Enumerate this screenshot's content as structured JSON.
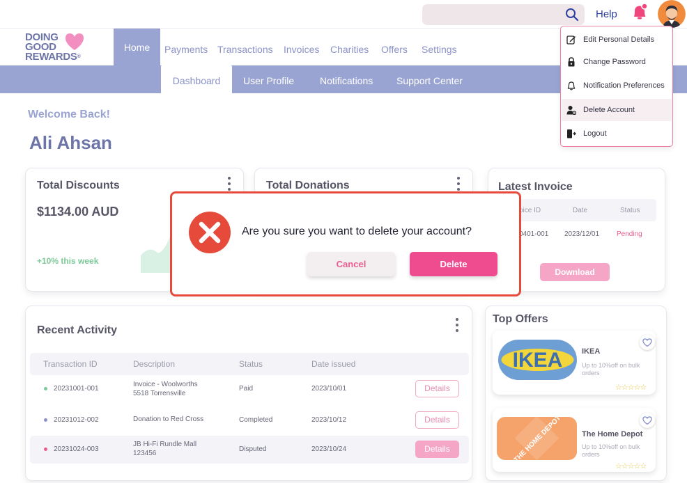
{
  "header": {
    "search_placeholder": "",
    "help_label": "Help",
    "logo_text": [
      "DOING",
      "GOOD",
      "REWARDS"
    ],
    "logo_reg": "®"
  },
  "nav": {
    "items": [
      "Home",
      "Payments",
      "Transactions",
      "Invoices",
      "Charities",
      "Offers",
      "Settings"
    ],
    "active": "Home"
  },
  "subnav": {
    "items": [
      "Dashboard",
      "User Profile",
      "Notifications",
      "Support Center"
    ],
    "active": "Dashboard"
  },
  "welcome": {
    "greeting": "Welcome Back!",
    "name": "Ali Ahsan"
  },
  "cards": {
    "discounts": {
      "title": "Total Discounts",
      "amount": "$1134.00 AUD",
      "change": "+10% this week"
    },
    "donations": {
      "title": "Total Donations"
    },
    "invoice": {
      "title": "Latest Invoice",
      "headers": [
        "oice ID",
        "Date",
        "Status"
      ],
      "row": [
        "0401-001",
        "2023/12/01",
        "Pending"
      ],
      "download_label": "Download"
    }
  },
  "recent_activity": {
    "title": "Recent Activity",
    "headers": [
      "Transaction ID",
      "Description",
      "Status",
      "Date issued"
    ],
    "rows": [
      {
        "id": "20231001-001",
        "desc1": "Invoice - Woolworths",
        "desc2": "5518 Torrensville",
        "status": "Paid",
        "date": "2023/10/01",
        "action": "Details"
      },
      {
        "id": "20231012-002",
        "desc1": "Donation to Red Cross",
        "desc2": "",
        "status": "Completed",
        "date": "2023/10/12",
        "action": "Details"
      },
      {
        "id": "20231024-003",
        "desc1": "JB Hi-Fi Rundle Mall",
        "desc2": "123456",
        "status": "Disputed",
        "date": "2023/10/24",
        "action": "Details"
      }
    ],
    "dot_colors": [
      "#7dc898",
      "#8a92c8",
      "#ea5d8f"
    ]
  },
  "offers": {
    "title": "Top Offers",
    "items": [
      {
        "name": "IKEA",
        "desc": "Up to 10%off on bulk orders",
        "logo_text": "IKEA",
        "stars": "☆☆☆☆☆"
      },
      {
        "name": "The Home Depot",
        "desc": "Up to 10%off on bulk orders",
        "logo_text": "THE HOME DEPOT",
        "stars": "☆☆☆☆☆"
      }
    ]
  },
  "account_menu": {
    "items": [
      {
        "label": "Edit  Personal Details",
        "icon": "edit-icon"
      },
      {
        "label": "Change Password",
        "icon": "lock-icon"
      },
      {
        "label": "Notification Preferences",
        "icon": "bell-outline-icon"
      },
      {
        "label": "Delete Account",
        "icon": "delete-user-icon"
      },
      {
        "label": "Logout",
        "icon": "logout-icon"
      }
    ],
    "highlighted": "Delete Account"
  },
  "modal": {
    "question": "Are you sure you want to delete your account?",
    "cancel_label": "Cancel",
    "delete_label": "Delete"
  },
  "colors": {
    "brand": "#9aa4d2",
    "brand_dark": "#6d74a8",
    "accent_pink": "#ef4b8f",
    "danger_red": "#e64a3a",
    "positive_green": "#7dc898"
  }
}
